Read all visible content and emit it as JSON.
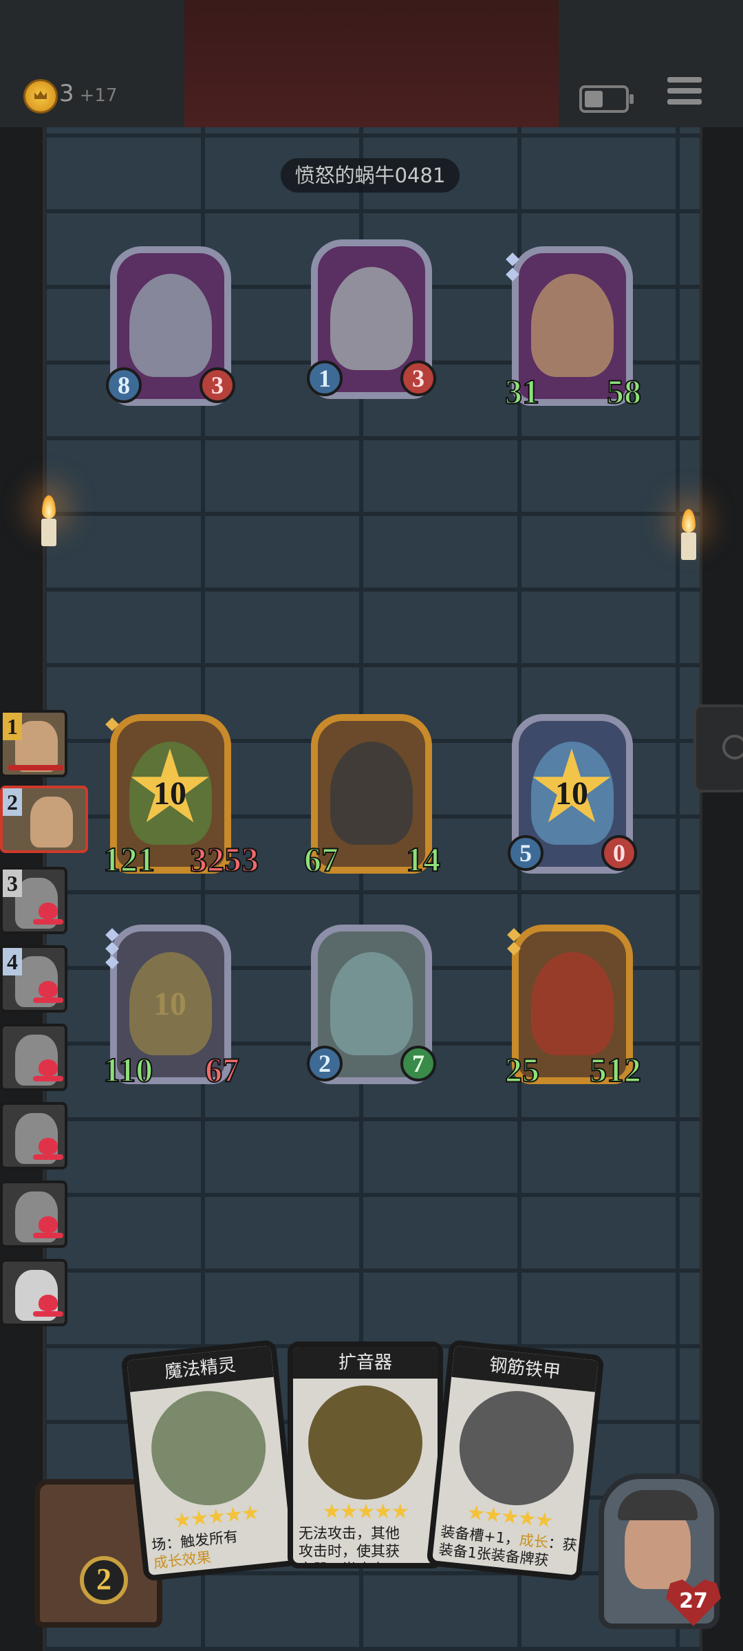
{
  "header": {
    "gold": "3",
    "gold_income": "+17",
    "opponent_name": "愤怒的蜗牛0481"
  },
  "enemy_units": [
    {
      "atk": "8",
      "hp": "3"
    },
    {
      "atk": "1",
      "hp": "3"
    },
    {
      "atk": "31",
      "hp": "58"
    }
  ],
  "player_units": [
    {
      "atk": "121",
      "hp": "3253",
      "level": "10"
    },
    {
      "atk": "67",
      "hp": "14"
    },
    {
      "atk": "5",
      "hp": "0",
      "level": "10"
    },
    {
      "atk": "110",
      "hp": "67",
      "level": "10"
    },
    {
      "atk": "2",
      "hp": "7"
    },
    {
      "atk": "25",
      "hp": "512"
    }
  ],
  "roster": [
    {
      "num": "1",
      "status": "alive"
    },
    {
      "num": "2",
      "status": "current"
    },
    {
      "num": "3",
      "status": "dead"
    },
    {
      "num": "4",
      "status": "dead"
    },
    {
      "num": "",
      "status": "dead"
    },
    {
      "num": "",
      "status": "dead"
    },
    {
      "num": "",
      "status": "dead"
    },
    {
      "num": "",
      "status": "dead"
    }
  ],
  "cards": [
    {
      "title": "魔法精灵",
      "stars": "★★★★★",
      "desc_1": "场：触发所有",
      "desc_2": "成长效果"
    },
    {
      "title": "扩音器",
      "stars": "★★★★★",
      "desc_1": "无法攻击，其他",
      "desc_2": "攻击时，使其获",
      "desc_3": "音器一半攻击"
    },
    {
      "title": "钢筋铁甲",
      "stars": "★★★★★",
      "desc_1": "装备槽+1，",
      "desc_1b": "成长",
      "desc_1c": "：获",
      "desc_2": "装备1张装备牌获"
    }
  ],
  "chest_count": "2",
  "player_health": "27",
  "colors": {
    "atk_green": "#8ee07a",
    "hp_red": "#f06a6a",
    "star_gold": "#f2c44a",
    "frame_purple": "#8e8fa8",
    "frame_gold": "#c88a2a"
  }
}
